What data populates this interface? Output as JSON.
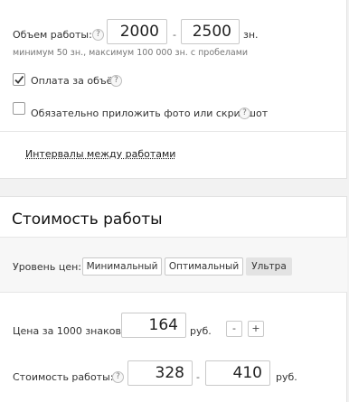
{
  "volume": {
    "label": "Объем работы:",
    "help": "?",
    "from": "2000",
    "separator": "-",
    "to": "2500",
    "unit": "зн.",
    "hint": "минимум 50 зн., максимум 100 000 зн. с пробелами"
  },
  "options": {
    "pay_per_volume": {
      "label": "Оплата за объём",
      "checked": true,
      "help": "?"
    },
    "attach_photo": {
      "label": "Обязательно приложить фото или скриншот",
      "checked": false,
      "help": "?"
    }
  },
  "intervals_link": "Интервалы между работами",
  "cost": {
    "title": "Стоимость работы",
    "price_level_label": "Уровень цен:",
    "levels": [
      "Минимальный",
      "Оптимальный",
      "Ультра"
    ],
    "active_level": "Ультра",
    "per1000_label": "Цена за 1000 знаков:",
    "per1000_value": "164",
    "currency": "руб.",
    "minus": "-",
    "plus": "+",
    "total_label": "Стоимость работы:",
    "help": "?",
    "total_from": "328",
    "separator": "-",
    "total_to": "410",
    "total_currency": "руб."
  }
}
